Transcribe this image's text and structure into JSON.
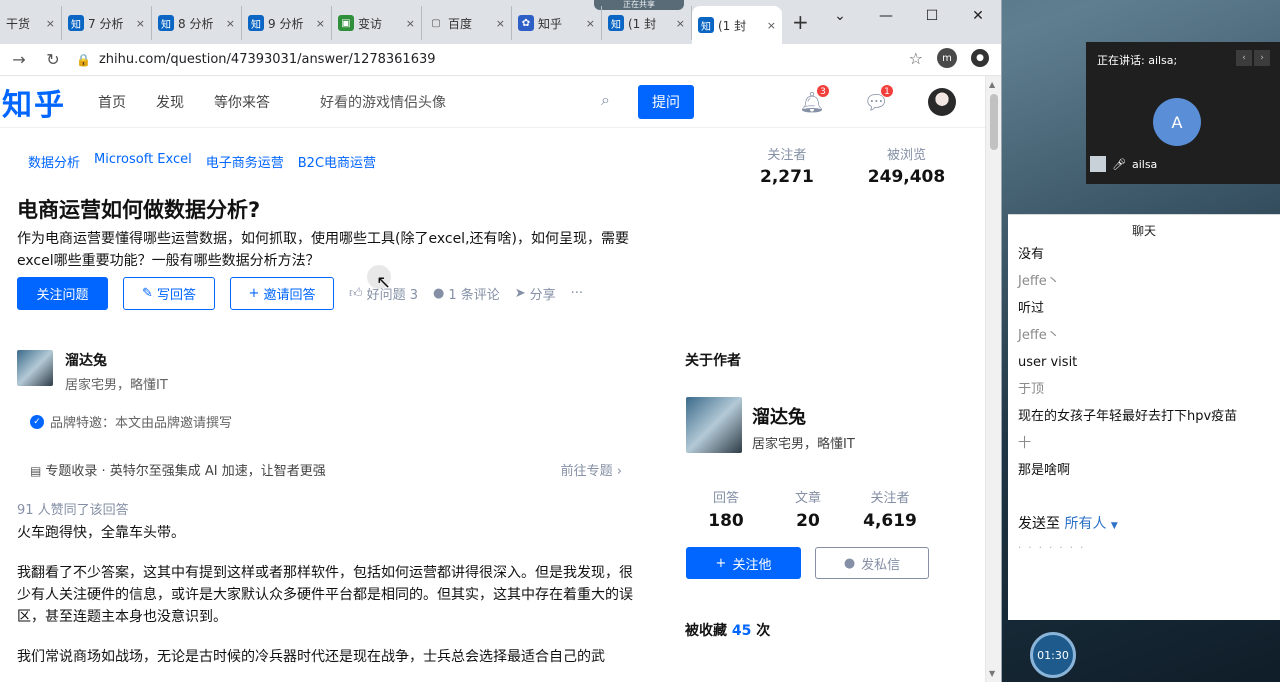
{
  "browser": {
    "share_indicator": "正在共享",
    "tabs": [
      {
        "fav": "",
        "label": "干货",
        "close": "×"
      },
      {
        "fav": "知",
        "label": "7 分析",
        "close": "×"
      },
      {
        "fav": "知",
        "label": "8 分析",
        "close": "×"
      },
      {
        "fav": "知",
        "label": "9 分析",
        "close": "×"
      },
      {
        "fav": "▣",
        "label": "变访",
        "close": "×"
      },
      {
        "fav": "",
        "label": "百度",
        "close": "×"
      },
      {
        "fav": "🐾",
        "label": "知乎",
        "close": "×"
      },
      {
        "fav": "知",
        "label": "(1 封",
        "close": "×"
      },
      {
        "fav": "知",
        "label": "(1 封",
        "close": "×"
      }
    ],
    "new_tab": "+",
    "url": "zhihu.com/question/47393031/answer/1278361639",
    "profile_initial": "m"
  },
  "zhihu": {
    "logo": "知乎",
    "nav": [
      "首页",
      "发现",
      "等你来答"
    ],
    "search_text": "好看的游戏情侣头像",
    "ask_label": "提问",
    "notif_count": "3",
    "msg_count": "1"
  },
  "question": {
    "topics": [
      "数据分析",
      "Microsoft Excel",
      "电子商务运营",
      "B2C电商运营"
    ],
    "followers_label": "关注者",
    "followers": "2,271",
    "views_label": "被浏览",
    "views": "249,408",
    "title": "电商运营如何做数据分析?",
    "description": "作为电商运营要懂得哪些运营数据，如何抓取，使用哪些工具(除了excel,还有啥)，如何呈现，需要excel哪些重要功能？一般有哪些数据分析方法？",
    "follow_btn": "关注问题",
    "write_btn": "写回答",
    "invite_btn": "邀请回答",
    "good_q": "好问题 3",
    "comments": "1 条评论",
    "share": "分享",
    "more": "···"
  },
  "answer": {
    "author_name": "溜达兔",
    "author_bio": "居家宅男，略懂IT",
    "brand_note": "品牌特邀：本文由品牌邀请撰写",
    "column": "专题收录 · 英特尔至强集成 AI 加速，让智者更强",
    "column_link": "前往专题",
    "upvotes": "91 人赞同了该回答",
    "paragraphs": [
      "火车跑得快，全靠车头带。",
      "我翻看了不少答案，这其中有提到这样或者那样软件，包括如何运营都讲得很深入。但是我发现，很少有人关注硬件的信息，或许是大家默认众多硬件平台都是相同的。但其实，这其中存在着重大的误区，甚至连题主本身也没意识到。",
      "我们常说商场如战场，无论是古时候的冷兵器时代还是现在战争，士兵总会选择最适合自己的武"
    ]
  },
  "about": {
    "title": "关于作者",
    "name": "溜达兔",
    "bio": "居家宅男，略懂IT",
    "stats": [
      {
        "label": "回答",
        "value": "180"
      },
      {
        "label": "文章",
        "value": "20"
      },
      {
        "label": "关注者",
        "value": "4,619"
      }
    ],
    "follow_btn": "关注他",
    "message_btn": "发私信",
    "collected_prefix": "被收藏",
    "collected_count": "45",
    "collected_suffix": "次"
  },
  "meeting": {
    "speaking": "正在讲话: ailsa;",
    "avatar_initial": "A",
    "participant": "ailsa",
    "chat_title": "聊天",
    "messages": [
      {
        "text": "没有",
        "type": "msg"
      },
      {
        "text": "Jeffe丶",
        "type": "sender"
      },
      {
        "text": "听过",
        "type": "msg"
      },
      {
        "text": "Jeffe丶",
        "type": "sender"
      },
      {
        "text": "user visit",
        "type": "msg"
      },
      {
        "text": "于顶",
        "type": "sender"
      },
      {
        "text": "现在的女孩子年轻最好去打下hpv疫苗",
        "type": "msg"
      },
      {
        "text": "十",
        "type": "sender"
      },
      {
        "text": "那是啥啊",
        "type": "msg"
      }
    ],
    "send_to_label": "发送至",
    "send_to_target": "所有人",
    "timer": "01:30"
  }
}
